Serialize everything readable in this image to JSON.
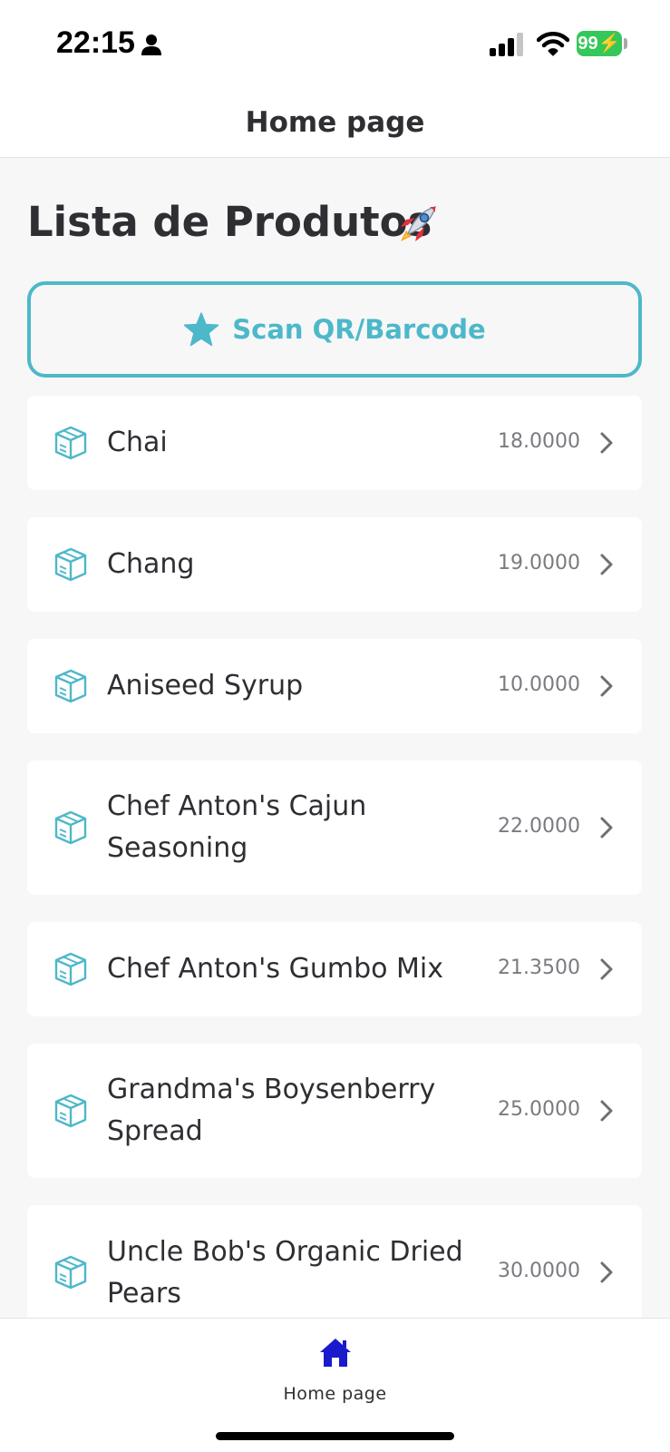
{
  "status_bar": {
    "time": "22:15",
    "battery": "99",
    "icons": [
      "person-icon",
      "cellular-signal-icon",
      "wifi-icon",
      "battery-charging-icon"
    ]
  },
  "header": {
    "title": "Home page"
  },
  "page": {
    "title": "Lista de Produtos",
    "title_emoji_icon": "rocket-icon"
  },
  "scan_button": {
    "label": "Scan QR/Barcode",
    "icon": "star-icon",
    "accent": "#4db8c9"
  },
  "products": [
    {
      "name": "Chai",
      "price": "18.0000"
    },
    {
      "name": "Chang",
      "price": "19.0000"
    },
    {
      "name": "Aniseed Syrup",
      "price": "10.0000"
    },
    {
      "name": "Chef Anton's Cajun Seasoning",
      "price": "22.0000"
    },
    {
      "name": "Chef Anton's Gumbo Mix",
      "price": "21.3500"
    },
    {
      "name": "Grandma's Boysenberry Spread",
      "price": "25.0000"
    },
    {
      "name": "Uncle Bob's Organic Dried Pears",
      "price": "30.0000"
    }
  ],
  "tab_bar": {
    "home_label": "Home page",
    "active_color": "#1a1acc"
  }
}
